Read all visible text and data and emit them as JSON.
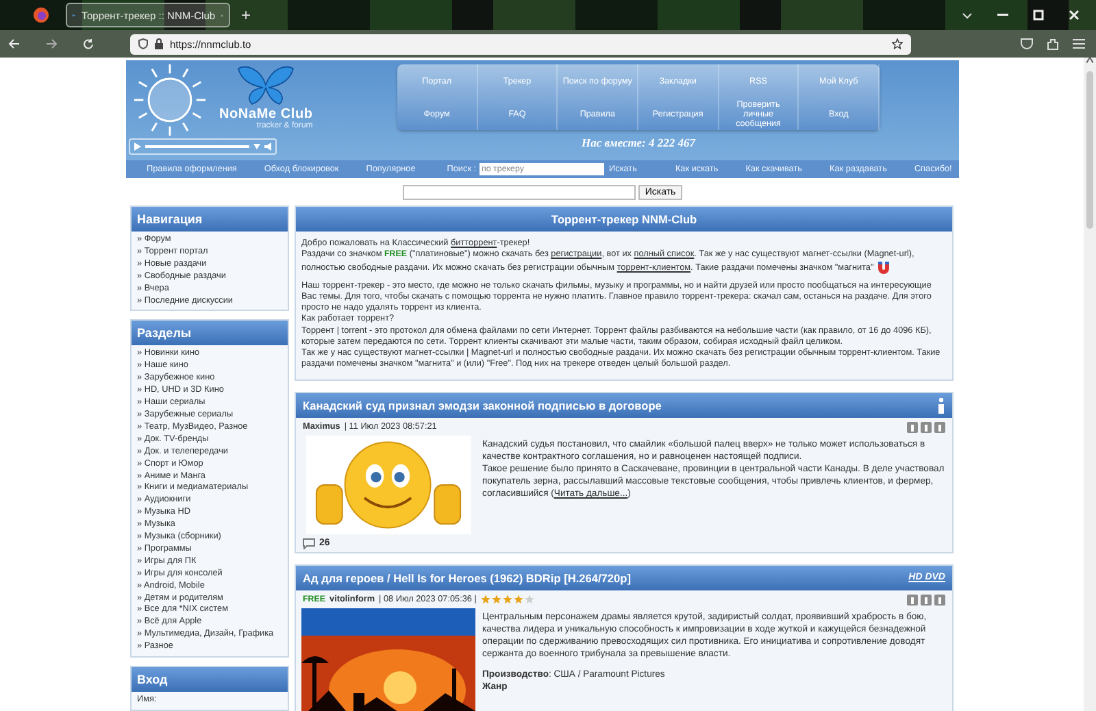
{
  "browser": {
    "tab_title": "Торрент-трекер :: NNM-Club",
    "new_tab": "+",
    "url": "https://nnmclub.to"
  },
  "header": {
    "logo_title": "NoNaMe Club",
    "logo_subtitle": "tracker & forum",
    "nav": [
      [
        "Портал",
        "Трекер",
        "Поиск по форуму",
        "Закладки",
        "RSS",
        "Мой Клуб"
      ],
      [
        "Форум",
        "FAQ",
        "Правила",
        "Регистрация",
        "Проверить личные сообщения",
        "Вход"
      ]
    ],
    "members": "Нас вместе: 4 222 467",
    "links_left": [
      "Правила оформления",
      "Обход блокировок",
      "Популярное"
    ],
    "search_label": "Поиск :",
    "search_placeholder": "по трекеру",
    "search_button": "Искать",
    "links_right": [
      "Как искать",
      "Как скачивать",
      "Как раздавать",
      "Спасибо!"
    ]
  },
  "search": {
    "button": "Искать"
  },
  "sidebar": [
    {
      "title": "Навигация",
      "items": [
        "» Форум",
        "» Торрент портал",
        "» Новые раздачи",
        "» Свободные раздачи",
        "» Вчера",
        "» Последние дискуссии"
      ]
    },
    {
      "title": "Разделы",
      "items": [
        "» Новинки кино",
        "» Наше кино",
        "» Зарубежное кино",
        "» HD, UHD и 3D Кино",
        "» Наши сериалы",
        "» Зарубежные сериалы",
        "» Театр, МузВидео, Разное",
        "» Док. TV-бренды",
        "» Док. и телепередачи",
        "» Спорт и Юмор",
        "» Аниме и Манга",
        "» Книги и медиаматериалы",
        "» Аудиокниги",
        "» Музыка HD",
        "» Музыка",
        "» Музыка (сборники)",
        "» Программы",
        "» Игры для ПК",
        "» Игры для консолей",
        "» Android, Mobile",
        "» Детям и родителям",
        "» Все для *NIX систем",
        "» Всё для Apple",
        "» Мультимедиа, Дизайн, Графика",
        "» Разное"
      ]
    },
    {
      "title": "Вход",
      "items": [
        "Имя:"
      ]
    }
  ],
  "intro": {
    "title": "Торрент-трекер NNM-Club",
    "groups": [
      [
        [
          {
            "kind": "text",
            "text": "Добро пожаловать на Классический "
          },
          {
            "kind": "link",
            "text": "битторрент"
          },
          {
            "kind": "text",
            "text": "-трекер!"
          }
        ],
        [
          {
            "kind": "text",
            "text": "Раздачи со значком "
          },
          {
            "kind": "badge",
            "text": "FREE"
          },
          {
            "kind": "text",
            "text": " (\"платиновые\") можно скачать без "
          },
          {
            "kind": "link",
            "text": "регистрации"
          },
          {
            "kind": "text",
            "text": ", вот их "
          },
          {
            "kind": "link",
            "text": "полный список"
          },
          {
            "kind": "text",
            "text": ". Так же у нас существуют магнет-ссылки (Magnet-url), полностью свободные раздачи. Их можно скачать без регистрации обычным "
          },
          {
            "kind": "link",
            "text": "торрент-клиентом"
          },
          {
            "kind": "text",
            "text": ". Такие раздачи помечены значком \"магнита\" "
          },
          {
            "kind": "magnet"
          }
        ]
      ],
      [
        [
          {
            "kind": "text",
            "text": "Наш торрент-трекер - это место, где можно не только скачать фильмы, музыку и программы, но и найти друзей или просто пообщаться на интересующие Вас темы. Для того, чтобы скачать с помощью торрента не нужно платить. Главное правило торрент-трекера: скачал сам, останься на раздаче. Для этого просто не надо удалять торрент из клиента."
          }
        ],
        [
          {
            "kind": "text",
            "text": "Как работает торрент?"
          }
        ],
        [
          {
            "kind": "text",
            "text": "Торрент | torrent - это протокол для обмена файлами по сети Интернет. Торрент файлы разбиваются на небольшие части (как правило, от 16 до 4096 КБ), которые затем передаются по сети. Торрент клиенты скачивают эти малые части, таким образом, собирая исходный файл целиком."
          }
        ],
        [
          {
            "kind": "text",
            "text": "Так же у нас существуют магнет-ссылки | Magnet-url и полностью свободные раздачи. Их можно скачать без регистрации обычным торрент-клиентом. Такие раздачи помечены значком \"магнита\" и (или) \"Free\". Под них на трекере отведен целый большой раздел."
          }
        ]
      ]
    ]
  },
  "news": [
    {
      "kind": "news",
      "title": "Канадский суд признал эмодзи законной подписью в договоре",
      "author": "Maximus",
      "date": "| 11 Июл 2023 08:57:21",
      "paragraphs": [
        [
          {
            "kind": "text",
            "text": "Канадский судья постановил, что смайлик «большой палец вверх» не только может использоваться в качестве контрактного соглашения, но и равноценен настоящей подписи."
          }
        ],
        [
          {
            "kind": "text",
            "text": "Такое решение было принято в Саскачеване, провинции в центральной части Канады. В деле участвовал покупатель зерна, рассылавший массовые текстовые сообщения, чтобы привлечь клиентов, и фермер, согласившийся ("
          },
          {
            "kind": "link",
            "text": "Читать дальше..."
          },
          {
            "kind": "text",
            "text": ")"
          }
        ]
      ],
      "comments": "26"
    },
    {
      "kind": "release",
      "title": "Ад для героев / Hell Is for Heroes (1962) BDRip [H.264/720p]",
      "format": "HD DVD",
      "free_badge": "FREE",
      "author": "vitolinform",
      "date": "| 08 Июл 2023 07:05:36 |",
      "stars": 4,
      "paragraphs": [
        [
          {
            "kind": "text",
            "text": "Центральным персонажем драмы является крутой, задиристый солдат, проявивший храбрость в бою, качества лидера и уникальную способность к импровизации в ходе жуткой и кажущейся безнадежной операции по сдерживанию превосходящих сил противника. Его инициатива и сопротивление доводят сержанта до военного трибунала за превышение власти."
          }
        ]
      ],
      "details": [
        {
          "label": "Производство",
          "value": ": США / Paramount Pictures"
        },
        {
          "label": "Жанр"
        }
      ]
    }
  ]
}
